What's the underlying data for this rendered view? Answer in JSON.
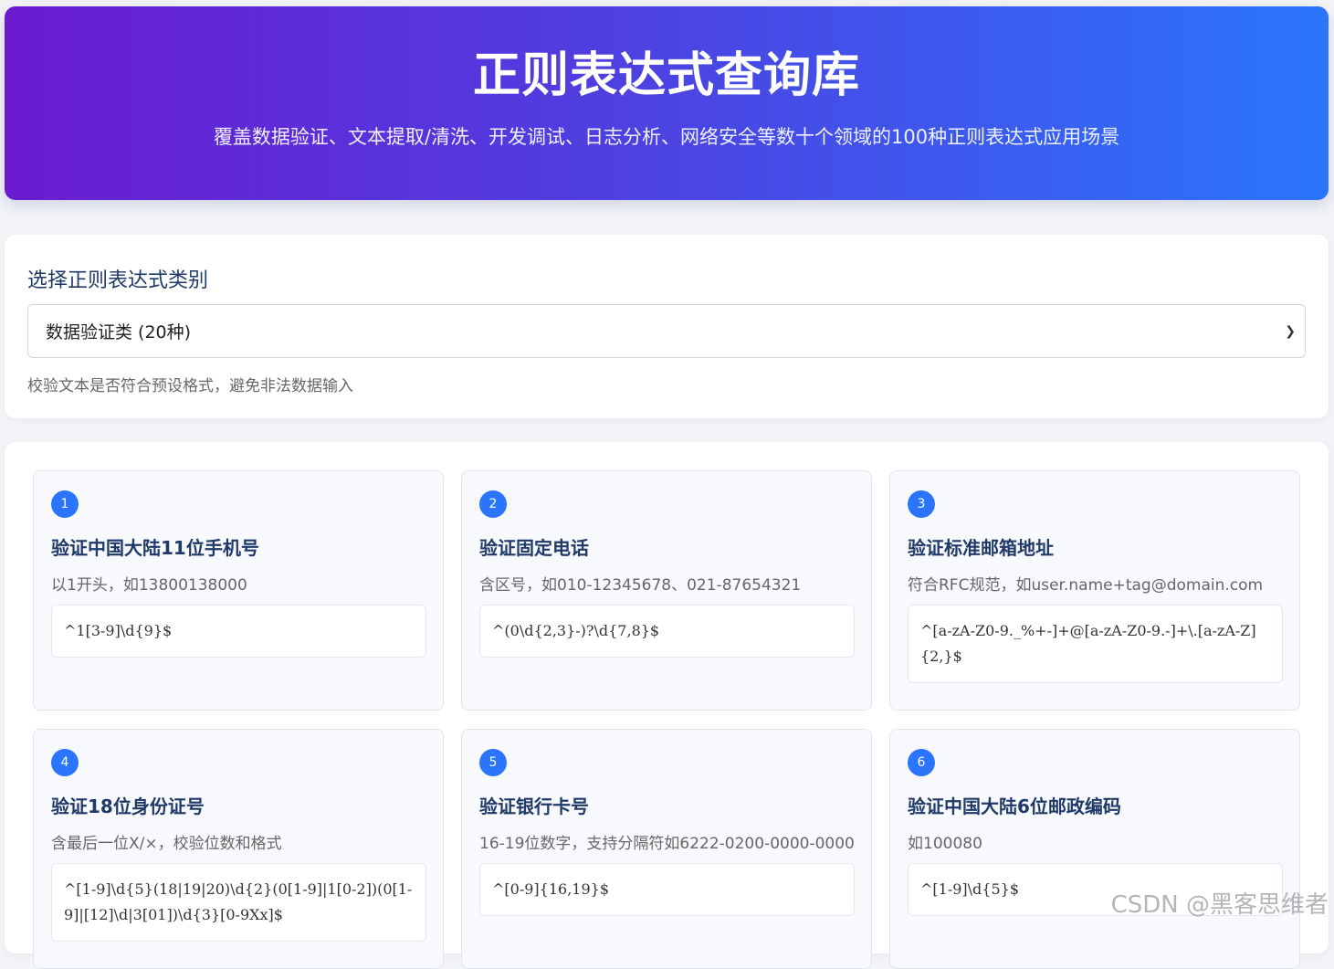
{
  "header": {
    "title": "正则表达式查询库",
    "subtitle": "覆盖数据验证、文本提取/清洗、开发调试、日志分析、网络安全等数十个领域的100种正则表达式应用场景"
  },
  "category": {
    "label": "选择正则表达式类别",
    "selected": "数据验证类 (20种)",
    "description": "校验文本是否符合预设格式，避免非法数据输入"
  },
  "cards": [
    {
      "num": "1",
      "title": "验证中国大陆11位手机号",
      "desc": "以1开头，如13800138000",
      "regex": "^1[3-9]\\d{9}$"
    },
    {
      "num": "2",
      "title": "验证固定电话",
      "desc": "含区号，如010-12345678、021-87654321",
      "regex": "^(0\\d{2,3}-)?\\d{7,8}$"
    },
    {
      "num": "3",
      "title": "验证标准邮箱地址",
      "desc": "符合RFC规范，如user.name+tag@domain.com",
      "regex": "^[a-zA-Z0-9._%+-]+@[a-zA-Z0-9.-]+\\.[a-zA-Z]{2,}$"
    },
    {
      "num": "4",
      "title": "验证18位身份证号",
      "desc": "含最后一位X/×，校验位数和格式",
      "regex": "^[1-9]\\d{5}(18|19|20)\\d{2}(0[1-9]|1[0-2])(0[1-9]|[12]\\d|3[01])\\d{3}[0-9Xx]$"
    },
    {
      "num": "5",
      "title": "验证银行卡号",
      "desc": "16-19位数字，支持分隔符如6222-0200-0000-0000",
      "regex": "^[0-9]{16,19}$"
    },
    {
      "num": "6",
      "title": "验证中国大陆6位邮政编码",
      "desc": "如100080",
      "regex": "^[1-9]\\d{5}$"
    }
  ],
  "watermark": "CSDN @黑客思维者"
}
